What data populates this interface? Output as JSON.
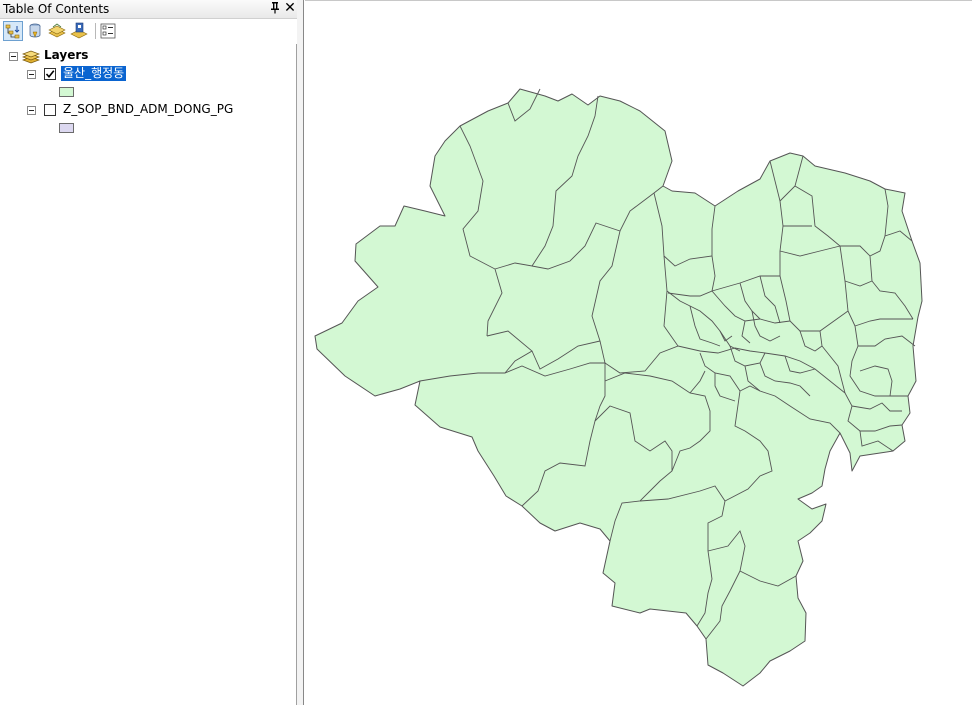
{
  "toc": {
    "title": "Table Of Contents",
    "pin_glyph": "ꟼ",
    "close_glyph": "✕",
    "toolbar": [
      {
        "name": "list-by-drawing-order-icon"
      },
      {
        "name": "list-by-source-icon"
      },
      {
        "name": "list-by-visibility-icon"
      },
      {
        "name": "list-by-selection-icon"
      },
      {
        "name": "options-icon"
      }
    ],
    "layers_label": "Layers",
    "layers": [
      {
        "name": "울산_행정동",
        "checked": true,
        "selected": true,
        "swatch_color": "#d3f8d3"
      },
      {
        "name": "Z_SOP_BND_ADM_DONG_PG",
        "checked": false,
        "selected": false,
        "swatch_color": "#dcd8f0"
      }
    ]
  },
  "map": {
    "fill_color": "#d3f8d3",
    "stroke_color": "#555555"
  }
}
